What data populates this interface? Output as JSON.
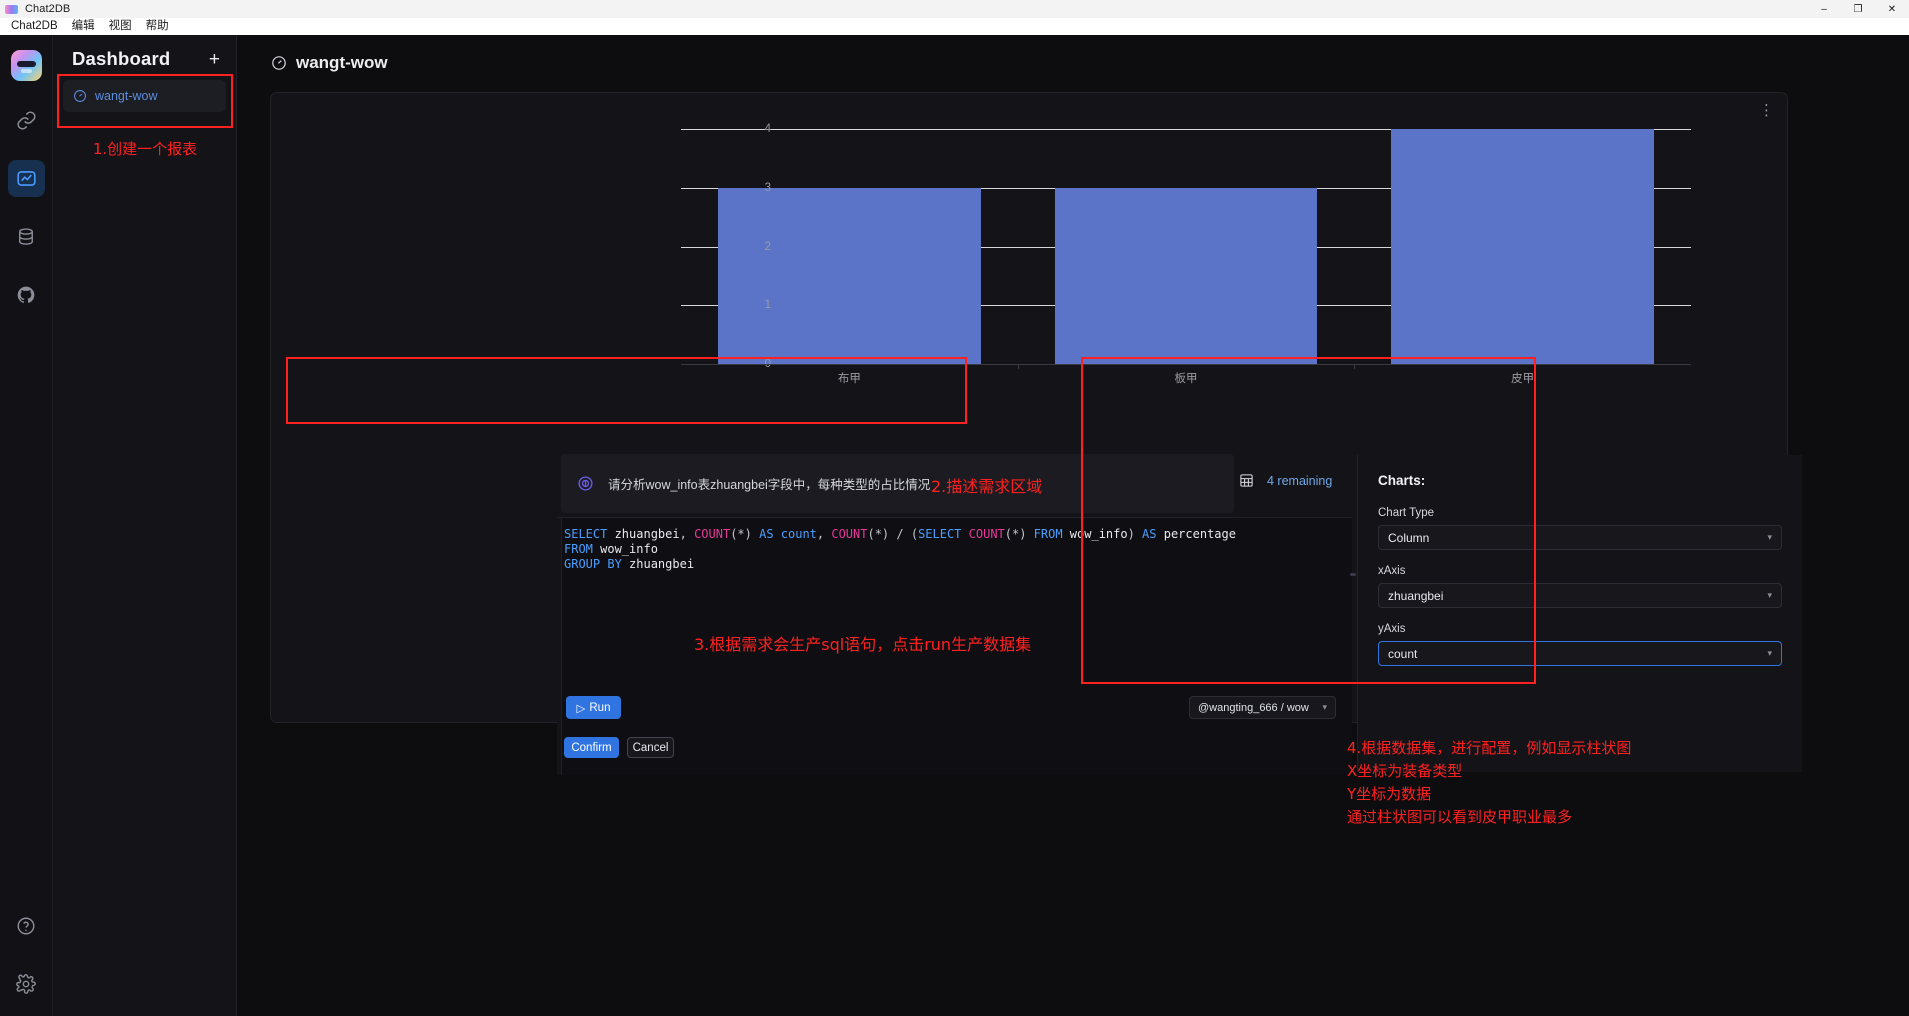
{
  "window": {
    "title": "Chat2DB",
    "logo_icon": "chat2db-logo-icon",
    "minimize_label": "–",
    "maximize_label": "❐",
    "close_label": "✕"
  },
  "menubar": {
    "items": [
      {
        "label": "Chat2DB"
      },
      {
        "label": "编辑"
      },
      {
        "label": "视图"
      },
      {
        "label": "帮助"
      }
    ]
  },
  "rail": {
    "logo_icon": "app-logo-icon",
    "items": [
      {
        "name": "connections-icon",
        "active": false
      },
      {
        "name": "dashboard-icon",
        "active": true
      },
      {
        "name": "database-icon",
        "active": false
      },
      {
        "name": "github-icon",
        "active": false
      }
    ],
    "bottom_items": [
      {
        "name": "help-icon"
      },
      {
        "name": "settings-icon"
      }
    ]
  },
  "sidebar": {
    "title": "Dashboard",
    "add_label": "+",
    "items": [
      {
        "label": "wangt-wow",
        "icon": "dashboard-dial-icon",
        "selected": true
      }
    ],
    "annotation": "1.创建一个报表"
  },
  "page": {
    "title": "wangt-wow",
    "title_icon": "dashboard-dial-icon",
    "card_menu_label": "⋮"
  },
  "chart_data": {
    "type": "bar",
    "categories": [
      "布甲",
      "板甲",
      "皮甲"
    ],
    "values": [
      3,
      3,
      4
    ],
    "title": "",
    "xlabel": "",
    "ylabel": "",
    "yticks": [
      0,
      1,
      2,
      3,
      4
    ],
    "ylim": [
      0,
      4
    ],
    "grid": true,
    "legend": "none",
    "bar_color": "#5b74c8",
    "gridline_color": "#d8d8d8"
  },
  "prompt": {
    "icon": "ai-sparkle-icon",
    "text": "请分析wow_info表zhuangbei字段中，每种类型的占比情况",
    "annotation": "2.描述需求区域",
    "remaining_icon": "table-grid-icon",
    "remaining_text": "4 remaining"
  },
  "editor": {
    "sql_lines": [
      [
        {
          "t": "SELECT ",
          "c": "kw"
        },
        {
          "t": "zhuangbei",
          "c": "id"
        },
        {
          "t": ", ",
          "c": "pn"
        },
        {
          "t": "COUNT",
          "c": "fn"
        },
        {
          "t": "(*) ",
          "c": "pn"
        },
        {
          "t": "AS ",
          "c": "kw"
        },
        {
          "t": "count",
          "c": "kw"
        },
        {
          "t": ", ",
          "c": "pn"
        },
        {
          "t": "COUNT",
          "c": "fn"
        },
        {
          "t": "(*) / (",
          "c": "pn"
        },
        {
          "t": "SELECT ",
          "c": "kw"
        },
        {
          "t": "COUNT",
          "c": "fn"
        },
        {
          "t": "(*) ",
          "c": "pn"
        },
        {
          "t": "FROM ",
          "c": "kw"
        },
        {
          "t": "wow_info",
          "c": "id"
        },
        {
          "t": ") ",
          "c": "pn"
        },
        {
          "t": "AS ",
          "c": "kw"
        },
        {
          "t": "percentage",
          "c": "id"
        }
      ],
      [
        {
          "t": "FROM ",
          "c": "kw"
        },
        {
          "t": "wow_info",
          "c": "id"
        }
      ],
      [
        {
          "t": "GROUP BY ",
          "c": "kw"
        },
        {
          "t": "zhuangbei",
          "c": "id"
        }
      ]
    ],
    "annotation": "3.根据需求会生产sql语句，点击run生产数据集",
    "run_label": "Run",
    "run_icon": "play-icon",
    "connection_value": "@wangting_666 / wow",
    "confirm_label": "Confirm",
    "cancel_label": "Cancel"
  },
  "charts_panel": {
    "heading": "Charts:",
    "fields": [
      {
        "label": "Chart Type",
        "value": "Column",
        "focused": false
      },
      {
        "label": "xAxis",
        "value": "zhuangbei",
        "focused": false
      },
      {
        "label": "yAxis",
        "value": "count",
        "focused": true
      }
    ],
    "annotation_lines": [
      "4.根据数据集，进行配置，例如显示柱状图",
      "X坐标为装备类型",
      "Y坐标为数据",
      "通过柱状图可以看到皮甲职业最多"
    ]
  },
  "colors": {
    "accent": "#2f74e0",
    "bar": "#5b74c8",
    "annotation": "#ff2020",
    "link": "#5b8dd9"
  }
}
